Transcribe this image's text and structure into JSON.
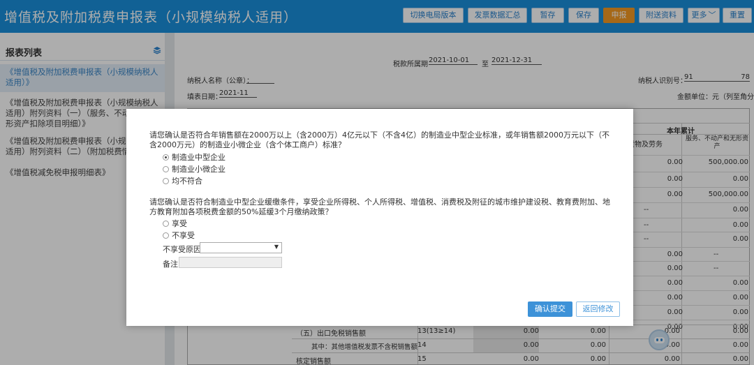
{
  "header": {
    "title": "增值税及附加税费申报表（小规模纳税人适用）",
    "buttons": [
      {
        "label": "切换电局版本"
      },
      {
        "label": "发票数据汇总"
      },
      {
        "label": "暂存"
      },
      {
        "label": "保存"
      },
      {
        "label": "申报"
      },
      {
        "label": "附送资料"
      },
      {
        "label": "更多"
      },
      {
        "label": "重置"
      }
    ]
  },
  "sidebar": {
    "title": "报表列表",
    "items": [
      {
        "label": "《增值税及附加税费申报表（小规模纳税人适用）》"
      },
      {
        "label": "《增值税及附加税费申报表（小规模纳税人适用）附列资料（一）（服务、不动产和无形资产扣除项目明细）》"
      },
      {
        "label": "《增值税及附加税费申报表（小规模纳税人适用）附列资料（二）（附加税费情况表）》"
      },
      {
        "label": "《增值税减免税申报明细表》"
      }
    ]
  },
  "form": {
    "period_label": "税款所属期",
    "period_start": "2021-10-01",
    "period_to": "至",
    "period_end": "2021-12-31",
    "taxpayer_name_label": "纳税人名称（公章）：",
    "taxpayer_id_label": "纳税人识别号：",
    "taxpayer_id_start": "91",
    "taxpayer_id_end": "78",
    "fill_date_label": "填表日期：",
    "fill_date": "2021-11",
    "unit_label": "金额单位：元（列至角分）",
    "col_year_total": "本年累计",
    "col_goods": "货物及劳务",
    "col_services": "服务、不动产和无形资产",
    "rows_right": [
      {
        "goods": "0.00",
        "services": "500,000.00"
      },
      {
        "goods": "0.00",
        "services": "0.00"
      },
      {
        "goods": "0.00",
        "services": "500,000.00"
      },
      {
        "goods": "--",
        "services": "0.00"
      },
      {
        "goods": "--",
        "services": "0.00"
      },
      {
        "goods": "--",
        "services": "0.00"
      }
    ],
    "rows_mid": [
      {
        "goods": "0.00",
        "services": "--"
      },
      {
        "goods": "0.00",
        "services": "--"
      },
      {
        "goods": "0.00",
        "services": "0.00"
      },
      {
        "goods": "0.00",
        "services": "0.00"
      },
      {
        "goods": "0.00",
        "services": "0.00"
      },
      {
        "goods": "0.00",
        "services": "0.00"
      }
    ],
    "bottom_rows": [
      {
        "name": "（五）出口免税销售额",
        "line": "13(13≥14)",
        "a": "0.00",
        "b": "0.00",
        "c": "0.00",
        "d": "0.00"
      },
      {
        "name": "其中：其他增值税发票不含税销售额",
        "line": "14",
        "a": "0.00",
        "b": "0.00",
        "c": "0.00",
        "d": "0.00"
      },
      {
        "name": "核定销售额",
        "line": "15",
        "a": "0.00",
        "b": "0.00",
        "c": "0.00",
        "d": "0.00"
      }
    ]
  },
  "dialog": {
    "q1": "请您确认是否符合年销售额在2000万以上（含2000万）4亿元以下（不含4亿）的制造业中型企业标准，或年销售额2000万元以下（不含2000万元）的制造业小微企业（含个体工商户）标准？",
    "q1_options": [
      {
        "label": "制造业中型企业"
      },
      {
        "label": "制造业小微企业"
      },
      {
        "label": "均不符合"
      }
    ],
    "q2": "请您确认是否符合制造业中型企业缓缴条件，享受企业所得税、个人所得税、增值税、消费税及附征的城市维护建设税、教育费附加、地方教育附加各项税费金额的50%延缓3个月缴纳政策？",
    "q2_options": [
      {
        "label": "享受"
      },
      {
        "label": "不享受"
      }
    ],
    "reason_label": "不享受原因:",
    "note_label": "备注:",
    "confirm_label": "确认提交",
    "back_label": "返回修改"
  }
}
